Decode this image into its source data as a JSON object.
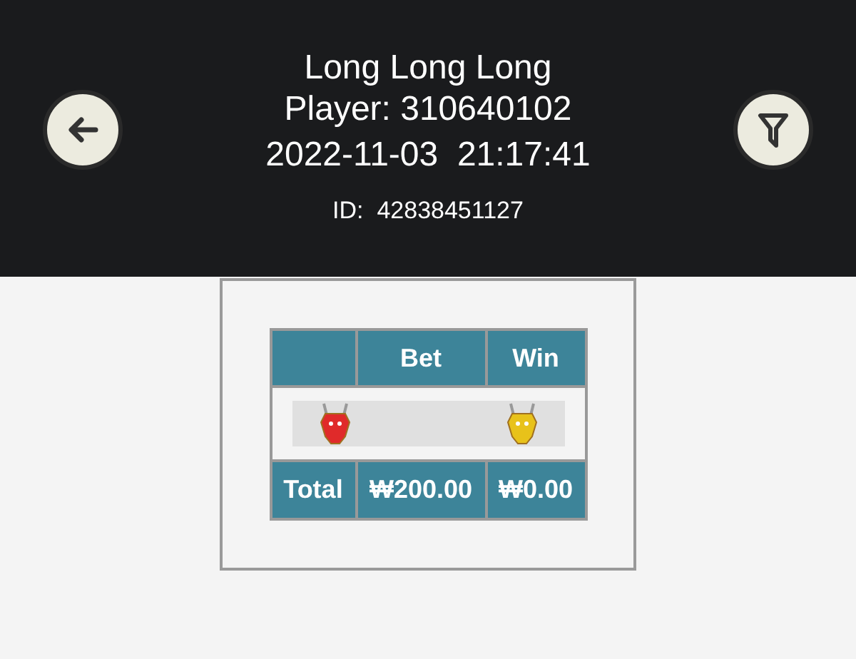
{
  "header": {
    "title": "Long Long Long",
    "player": "Player: 310640102",
    "datetime": "2022-11-03  21:17:41",
    "id": "ID:  42838451127"
  },
  "table": {
    "columns": [
      "",
      "Bet",
      "Win"
    ],
    "result_icons": [
      {
        "color": "#e02a2a"
      },
      {
        "color": "#e8c21a"
      }
    ],
    "total": [
      "Total",
      "₩200.00",
      "₩0.00"
    ]
  }
}
